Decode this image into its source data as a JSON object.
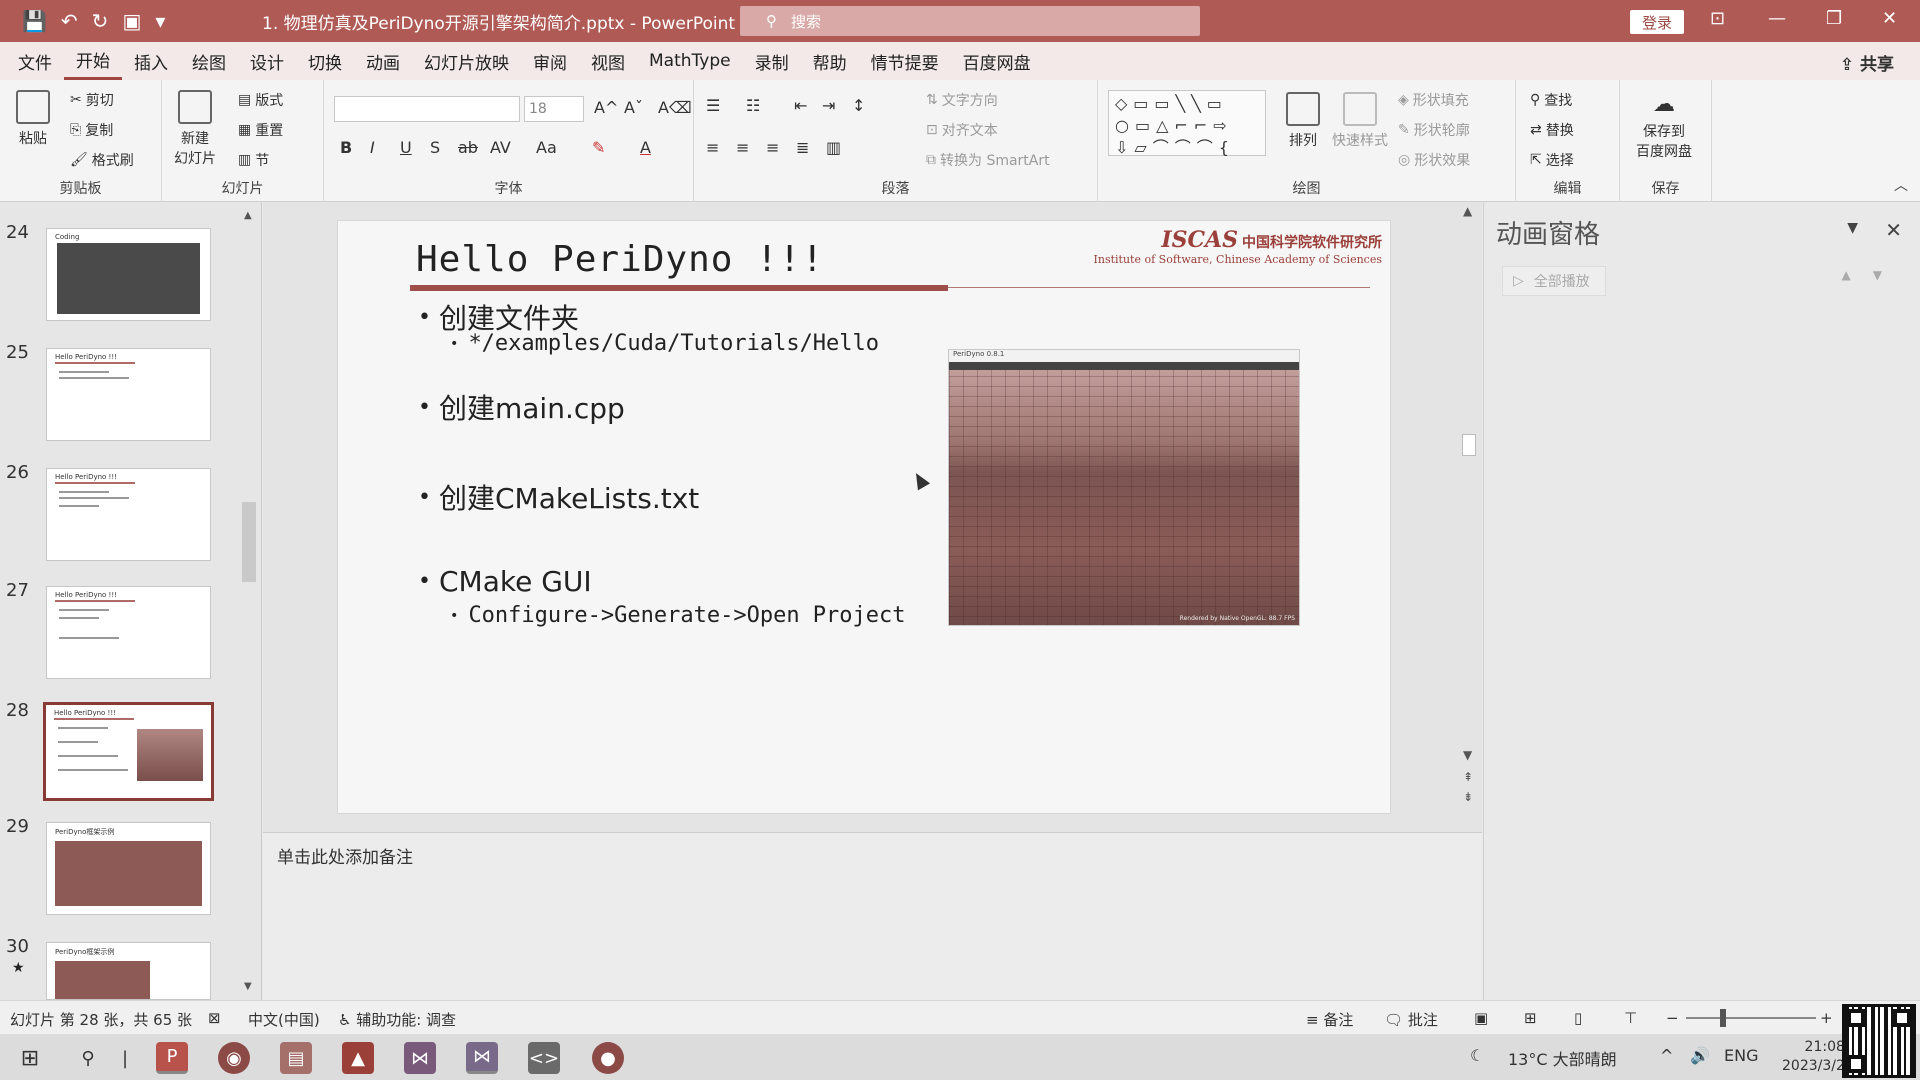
{
  "titlebar": {
    "doc_title": "1. 物理仿真及PeriDyno开源引擎架构简介.pptx  -  PowerPoint",
    "search_placeholder": "搜索",
    "login_label": "登录",
    "colors": {
      "accent": "#b05a55"
    }
  },
  "menu": {
    "tabs": [
      "文件",
      "开始",
      "插入",
      "绘图",
      "设计",
      "切换",
      "动画",
      "幻灯片放映",
      "审阅",
      "视图",
      "MathType",
      "录制",
      "帮助",
      "情节提要",
      "百度网盘"
    ],
    "active_index": 1,
    "share_label": "共享"
  },
  "ribbon": {
    "clipboard": {
      "paste": "粘贴",
      "cut": "剪切",
      "copy": "复制",
      "format_painter": "格式刷",
      "group": "剪贴板"
    },
    "slides": {
      "new_slide": "新建\n幻灯片",
      "layout": "版式",
      "reset": "重置",
      "section": "节",
      "group": "幻灯片"
    },
    "font": {
      "size": "18",
      "group": "字体",
      "buttons": [
        "B",
        "I",
        "U",
        "S",
        "ab",
        "AV",
        "Aa"
      ]
    },
    "paragraph": {
      "text_direction": "文字方向",
      "align_text": "对齐文本",
      "smartart": "转换为 SmartArt",
      "group": "段落"
    },
    "drawing": {
      "arrange": "排列",
      "quick_styles": "快速样式",
      "shape_fill": "形状填充",
      "shape_outline": "形状轮廓",
      "shape_effects": "形状效果",
      "group": "绘图"
    },
    "editing": {
      "find": "查找",
      "replace": "替换",
      "select": "选择",
      "group": "编辑"
    },
    "save": {
      "save_to": "保存到\n百度网盘",
      "group": "保存"
    }
  },
  "thumbnails": [
    {
      "num": "24",
      "title": "Coding",
      "kind": "dark"
    },
    {
      "num": "25",
      "title": "Hello PeriDyno !!!",
      "kind": "text"
    },
    {
      "num": "26",
      "title": "Hello PeriDyno !!!",
      "kind": "text"
    },
    {
      "num": "27",
      "title": "Hello PeriDyno !!!",
      "kind": "text"
    },
    {
      "num": "28",
      "title": "Hello PeriDyno !!!",
      "kind": "image",
      "active": true
    },
    {
      "num": "29",
      "title": "PeriDyno框架示例",
      "kind": "diagram"
    },
    {
      "num": "30",
      "title": "PeriDyno框架示例",
      "kind": "diagram"
    }
  ],
  "slide": {
    "title": "Hello PeriDyno !!!",
    "logo_main": "ISCAS",
    "logo_cn": "中国科学院软件研究所",
    "logo_en": "Institute of Software, Chinese Academy of Sciences",
    "bullets": [
      {
        "text": "创建文件夹",
        "sub": "*/examples/Cuda/Tutorials/Hello"
      },
      {
        "text": "创建main.cpp",
        "sub": ""
      },
      {
        "text": "创建CMakeLists.txt",
        "sub": ""
      },
      {
        "text": "CMake GUI",
        "sub": "Configure->Generate->Open Project"
      }
    ],
    "screenshot": {
      "window_title": "PeriDyno 0.8.1",
      "footer": "Rendered by Native OpenGL: 88.7 FPS"
    }
  },
  "notes": {
    "placeholder": "单击此处添加备注"
  },
  "animation_pane": {
    "title": "动画窗格",
    "play_all": "全部播放"
  },
  "statusbar": {
    "slide_info": "幻灯片 第 28 张，共 65 张",
    "language": "中文(中国)",
    "accessibility": "辅助功能: 调查",
    "notes": "备注",
    "comments": "批注"
  },
  "taskbar": {
    "weather": "13°C  大部晴朗",
    "lang": "ENG",
    "time": "21:08",
    "date": "2023/3/2"
  }
}
